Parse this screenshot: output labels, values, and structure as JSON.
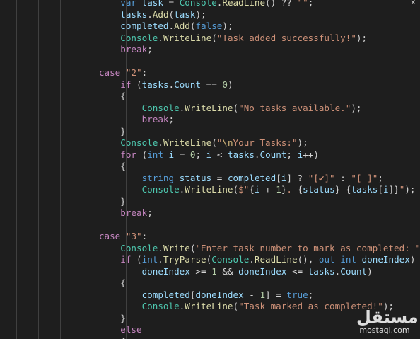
{
  "editor": {
    "lines": [
      [
        {
          "t": "        "
        },
        {
          "t": "var",
          "c": "kw"
        },
        {
          "t": " "
        },
        {
          "t": "task",
          "c": "var"
        },
        {
          "t": " = "
        },
        {
          "t": "Console",
          "c": "ty"
        },
        {
          "t": "."
        },
        {
          "t": "ReadLine",
          "c": "fn"
        },
        {
          "t": "() ?? "
        },
        {
          "t": "\"\"",
          "c": "str"
        },
        {
          "t": ";"
        }
      ],
      [
        {
          "t": "        "
        },
        {
          "t": "tasks",
          "c": "var"
        },
        {
          "t": "."
        },
        {
          "t": "Add",
          "c": "fn"
        },
        {
          "t": "("
        },
        {
          "t": "task",
          "c": "var"
        },
        {
          "t": ");"
        }
      ],
      [
        {
          "t": "        "
        },
        {
          "t": "completed",
          "c": "var"
        },
        {
          "t": "."
        },
        {
          "t": "Add",
          "c": "fn"
        },
        {
          "t": "("
        },
        {
          "t": "false",
          "c": "kw"
        },
        {
          "t": ");"
        }
      ],
      [
        {
          "t": "        "
        },
        {
          "t": "Console",
          "c": "ty"
        },
        {
          "t": "."
        },
        {
          "t": "WriteLine",
          "c": "fn"
        },
        {
          "t": "("
        },
        {
          "t": "\"Task added successfully!\"",
          "c": "str"
        },
        {
          "t": ");"
        }
      ],
      [
        {
          "t": "        "
        },
        {
          "t": "break",
          "c": "ctl"
        },
        {
          "t": ";"
        }
      ],
      [],
      [
        {
          "t": "    "
        },
        {
          "t": "case",
          "c": "ctl"
        },
        {
          "t": " "
        },
        {
          "t": "\"2\"",
          "c": "str"
        },
        {
          "t": ":"
        }
      ],
      [
        {
          "t": "        "
        },
        {
          "t": "if",
          "c": "ctl"
        },
        {
          "t": " ("
        },
        {
          "t": "tasks",
          "c": "var"
        },
        {
          "t": "."
        },
        {
          "t": "Count",
          "c": "var"
        },
        {
          "t": " == "
        },
        {
          "t": "0",
          "c": "num"
        },
        {
          "t": ")"
        }
      ],
      [
        {
          "t": "        {"
        }
      ],
      [
        {
          "t": "            "
        },
        {
          "t": "Console",
          "c": "ty"
        },
        {
          "t": "."
        },
        {
          "t": "WriteLine",
          "c": "fn"
        },
        {
          "t": "("
        },
        {
          "t": "\"No tasks available.\"",
          "c": "str"
        },
        {
          "t": ");"
        }
      ],
      [
        {
          "t": "            "
        },
        {
          "t": "break",
          "c": "ctl"
        },
        {
          "t": ";"
        }
      ],
      [
        {
          "t": "        }"
        }
      ],
      [
        {
          "t": "        "
        },
        {
          "t": "Console",
          "c": "ty"
        },
        {
          "t": "."
        },
        {
          "t": "WriteLine",
          "c": "fn"
        },
        {
          "t": "("
        },
        {
          "t": "\"",
          "c": "str"
        },
        {
          "t": "\\n",
          "c": "esc"
        },
        {
          "t": "Your Tasks:\"",
          "c": "str"
        },
        {
          "t": ");"
        }
      ],
      [
        {
          "t": "        "
        },
        {
          "t": "for",
          "c": "ctl"
        },
        {
          "t": " ("
        },
        {
          "t": "int",
          "c": "kw"
        },
        {
          "t": " "
        },
        {
          "t": "i",
          "c": "var"
        },
        {
          "t": " = "
        },
        {
          "t": "0",
          "c": "num"
        },
        {
          "t": "; "
        },
        {
          "t": "i",
          "c": "var"
        },
        {
          "t": " < "
        },
        {
          "t": "tasks",
          "c": "var"
        },
        {
          "t": "."
        },
        {
          "t": "Count",
          "c": "var"
        },
        {
          "t": "; "
        },
        {
          "t": "i",
          "c": "var"
        },
        {
          "t": "++)"
        }
      ],
      [
        {
          "t": "        {"
        }
      ],
      [
        {
          "t": "            "
        },
        {
          "t": "string",
          "c": "kw"
        },
        {
          "t": " "
        },
        {
          "t": "status",
          "c": "var"
        },
        {
          "t": " = "
        },
        {
          "t": "completed",
          "c": "var"
        },
        {
          "t": "["
        },
        {
          "t": "i",
          "c": "var"
        },
        {
          "t": "] ? "
        },
        {
          "t": "\"[✔]\"",
          "c": "str"
        },
        {
          "t": " : "
        },
        {
          "t": "\"[ ]\"",
          "c": "str"
        },
        {
          "t": ";"
        }
      ],
      [
        {
          "t": "            "
        },
        {
          "t": "Console",
          "c": "ty"
        },
        {
          "t": "."
        },
        {
          "t": "WriteLine",
          "c": "fn"
        },
        {
          "t": "("
        },
        {
          "t": "$\"",
          "c": "str"
        },
        {
          "t": "{"
        },
        {
          "t": "i",
          "c": "var"
        },
        {
          "t": " + "
        },
        {
          "t": "1",
          "c": "num"
        },
        {
          "t": "}"
        },
        {
          "t": ". ",
          "c": "str"
        },
        {
          "t": "{"
        },
        {
          "t": "status",
          "c": "var"
        },
        {
          "t": "}"
        },
        {
          "t": " ",
          "c": "str"
        },
        {
          "t": "{"
        },
        {
          "t": "tasks",
          "c": "var"
        },
        {
          "t": "["
        },
        {
          "t": "i",
          "c": "var"
        },
        {
          "t": "]}"
        },
        {
          "t": "\"",
          "c": "str"
        },
        {
          "t": ");"
        }
      ],
      [
        {
          "t": "        }"
        }
      ],
      [
        {
          "t": "        "
        },
        {
          "t": "break",
          "c": "ctl"
        },
        {
          "t": ";"
        }
      ],
      [],
      [
        {
          "t": "    "
        },
        {
          "t": "case",
          "c": "ctl"
        },
        {
          "t": " "
        },
        {
          "t": "\"3\"",
          "c": "str"
        },
        {
          "t": ":"
        }
      ],
      [
        {
          "t": "        "
        },
        {
          "t": "Console",
          "c": "ty"
        },
        {
          "t": "."
        },
        {
          "t": "Write",
          "c": "fn"
        },
        {
          "t": "("
        },
        {
          "t": "\"Enter task number to mark as completed: \"",
          "c": "str"
        },
        {
          "t": ");"
        }
      ],
      [
        {
          "t": "        "
        },
        {
          "t": "if",
          "c": "ctl"
        },
        {
          "t": " ("
        },
        {
          "t": "int",
          "c": "kw"
        },
        {
          "t": "."
        },
        {
          "t": "TryParse",
          "c": "fn"
        },
        {
          "t": "("
        },
        {
          "t": "Console",
          "c": "ty"
        },
        {
          "t": "."
        },
        {
          "t": "ReadLine",
          "c": "fn"
        },
        {
          "t": "(), "
        },
        {
          "t": "out",
          "c": "kw"
        },
        {
          "t": " "
        },
        {
          "t": "int",
          "c": "kw"
        },
        {
          "t": " "
        },
        {
          "t": "doneIndex",
          "c": "var"
        },
        {
          "t": ") &&"
        }
      ],
      [
        {
          "t": "            "
        },
        {
          "t": "doneIndex",
          "c": "var"
        },
        {
          "t": " >= "
        },
        {
          "t": "1",
          "c": "num"
        },
        {
          "t": " && "
        },
        {
          "t": "doneIndex",
          "c": "var"
        },
        {
          "t": " <= "
        },
        {
          "t": "tasks",
          "c": "var"
        },
        {
          "t": "."
        },
        {
          "t": "Count",
          "c": "var"
        },
        {
          "t": ")"
        }
      ],
      [
        {
          "t": "        {"
        }
      ],
      [
        {
          "t": "            "
        },
        {
          "t": "completed",
          "c": "var"
        },
        {
          "t": "["
        },
        {
          "t": "doneIndex",
          "c": "var"
        },
        {
          "t": " - "
        },
        {
          "t": "1",
          "c": "num"
        },
        {
          "t": "] = "
        },
        {
          "t": "true",
          "c": "kw"
        },
        {
          "t": ";"
        }
      ],
      [
        {
          "t": "            "
        },
        {
          "t": "Console",
          "c": "ty"
        },
        {
          "t": "."
        },
        {
          "t": "WriteLine",
          "c": "fn"
        },
        {
          "t": "("
        },
        {
          "t": "\"Task marked as completed!\"",
          "c": "str"
        },
        {
          "t": ");"
        }
      ],
      [
        {
          "t": "        }"
        }
      ],
      [
        {
          "t": "        "
        },
        {
          "t": "else",
          "c": "ctl"
        }
      ],
      [
        {
          "t": "        {"
        }
      ]
    ]
  },
  "watermark": {
    "arabic": "مستقل",
    "latin": "mostaql.com"
  },
  "close_glyph": "×",
  "colors": {
    "background": "#1e1e1e",
    "keyword": "#569cd6",
    "control": "#c586c0",
    "type": "#4ec9b0",
    "function": "#dcdcaa",
    "variable": "#9cdcfe",
    "string": "#ce9178",
    "number": "#b5cea8"
  }
}
